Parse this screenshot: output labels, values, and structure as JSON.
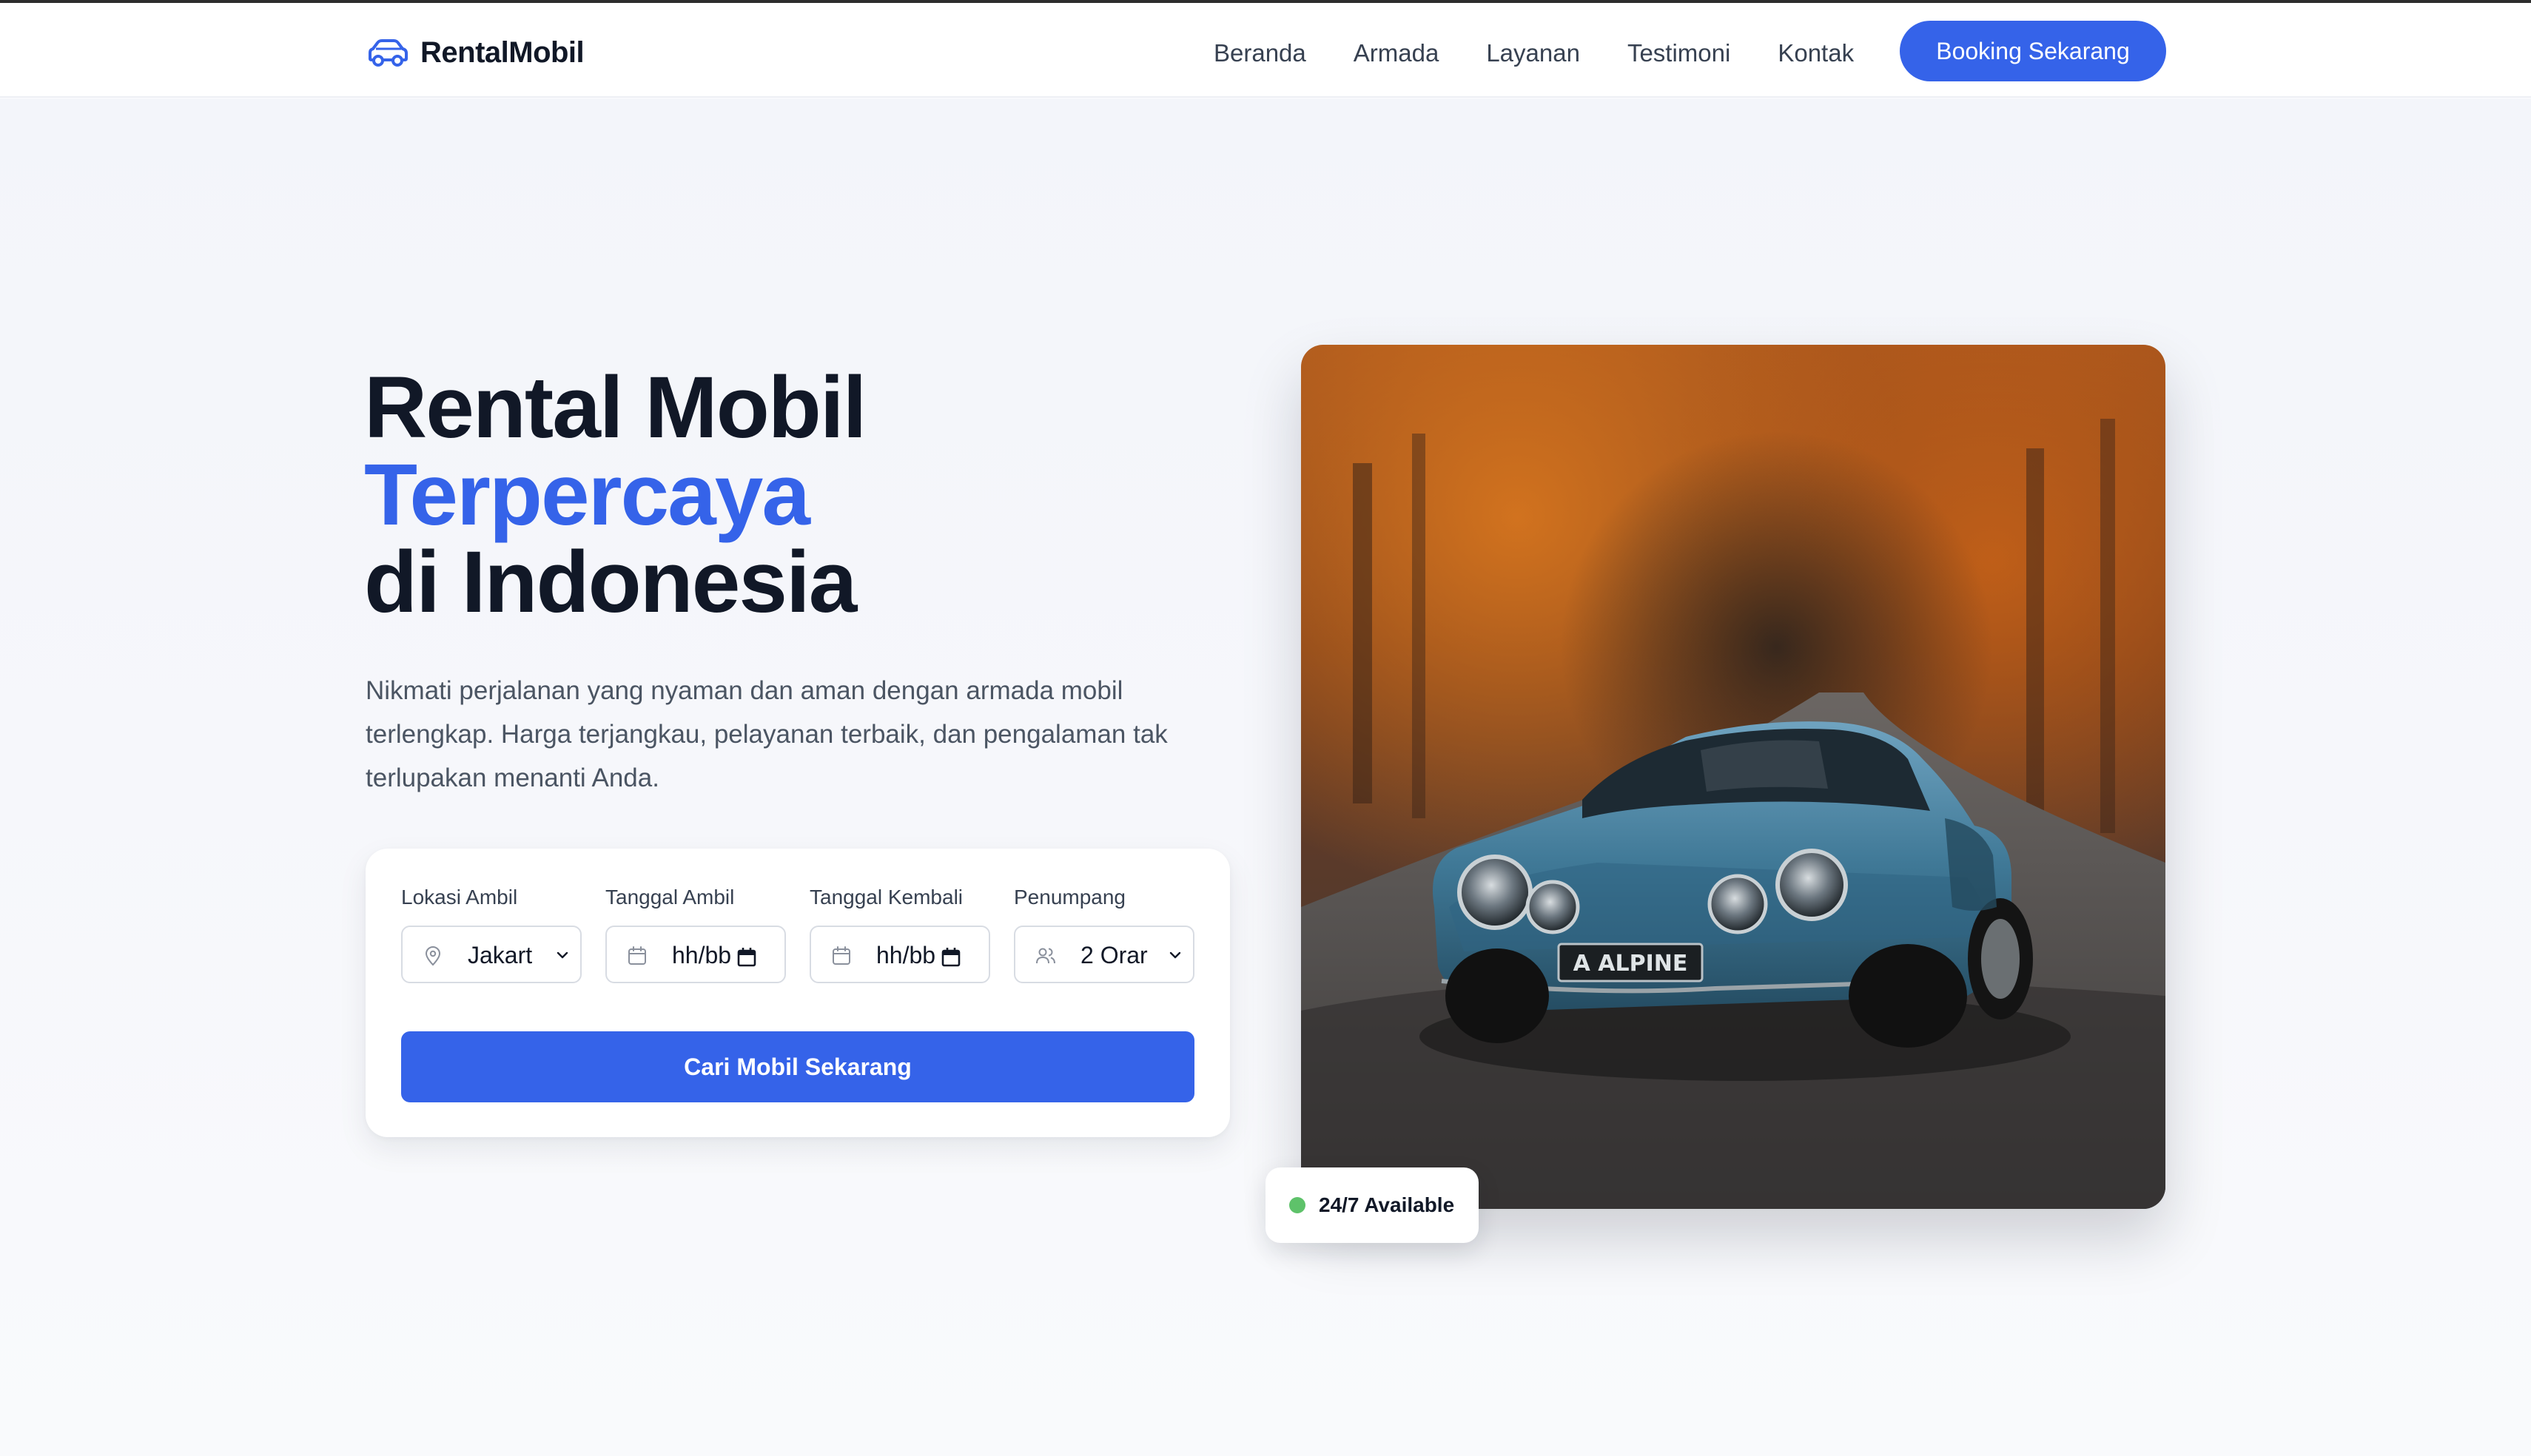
{
  "brand": {
    "name": "RentalMobil",
    "icon": "car-icon"
  },
  "nav": {
    "links": [
      "Beranda",
      "Armada",
      "Layanan",
      "Testimoni",
      "Kontak"
    ],
    "cta": "Booking Sekarang"
  },
  "hero": {
    "title_line1": "Rental Mobil",
    "title_line2": "Terpercaya",
    "title_line3": "di Indonesia",
    "description": "Nikmati perjalanan yang nyaman dan aman dengan armada mobil terlengkap. Harga terjangkau, pelayanan terbaik, dan pengalaman tak terlupakan menanti Anda."
  },
  "search": {
    "pickup_location": {
      "label": "Lokasi Ambil",
      "value": "Jakart",
      "icon": "map-pin-icon"
    },
    "pickup_date": {
      "label": "Tanggal Ambil",
      "value": "hh/bb",
      "icon": "calendar-icon"
    },
    "return_date": {
      "label": "Tanggal Kembali",
      "value": "hh/bb",
      "icon": "calendar-icon"
    },
    "passengers": {
      "label": "Penumpang",
      "value": "2 Orar",
      "icon": "users-icon"
    },
    "submit": "Cari Mobil Sekarang"
  },
  "badge": {
    "text": "24/7 Available",
    "dot_color": "#5ec26a"
  },
  "colors": {
    "accent": "#3563e9",
    "text": "#111827",
    "muted": "#4b5563"
  }
}
